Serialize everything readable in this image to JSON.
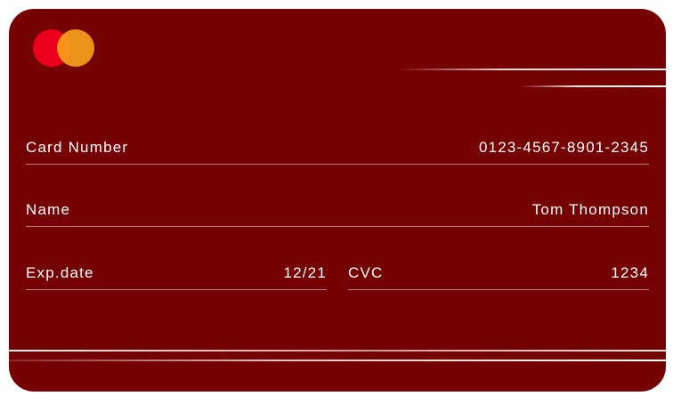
{
  "card": {
    "brand_icon": "mastercard-logo-icon",
    "colors": {
      "background": "#760303",
      "text": "#ffffff",
      "logo_red": "#eb001b",
      "logo_orange": "#f79e1b"
    },
    "fields": {
      "card_number": {
        "label": "Card Number",
        "value": "0123-4567-8901-2345"
      },
      "name": {
        "label": "Name",
        "value": "Tom Thompson"
      },
      "exp_date": {
        "label": "Exp.date",
        "value": "12/21"
      },
      "cvc": {
        "label": "CVC",
        "value": "1234"
      }
    }
  }
}
